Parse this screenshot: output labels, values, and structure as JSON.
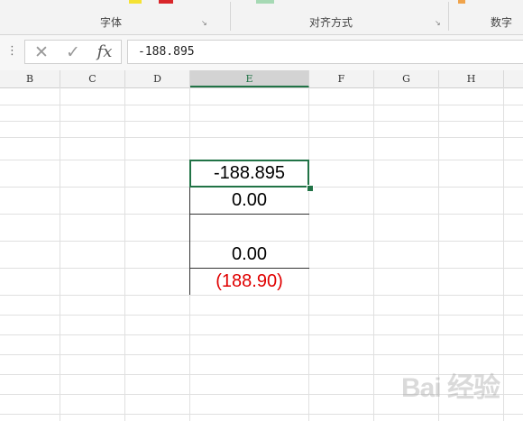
{
  "ribbon": {
    "groups": [
      {
        "label": "字体"
      },
      {
        "label": "对齐方式"
      },
      {
        "label": "数字"
      }
    ],
    "launcher_glyph": "↘",
    "swatches": {
      "yellow": "#f5e233",
      "red": "#d9262a",
      "green": "#a6d9b4",
      "orange": "#f0a34a"
    }
  },
  "formula_bar": {
    "grip": "⋮",
    "cancel_glyph": "✕",
    "enter_glyph": "✓",
    "fx_glyph": "fx",
    "value": "-188.895"
  },
  "columns": [
    "B",
    "C",
    "D",
    "E",
    "F",
    "G",
    "H"
  ],
  "selected_column": "E",
  "cells": {
    "e_row1": "-188.895",
    "e_row2": "0.00",
    "e_row3": "",
    "e_row4": "0.00",
    "e_row5": "(188.90)"
  },
  "colors": {
    "accent": "#217346",
    "negative": "#e00000"
  },
  "watermark": "Bai 经验"
}
